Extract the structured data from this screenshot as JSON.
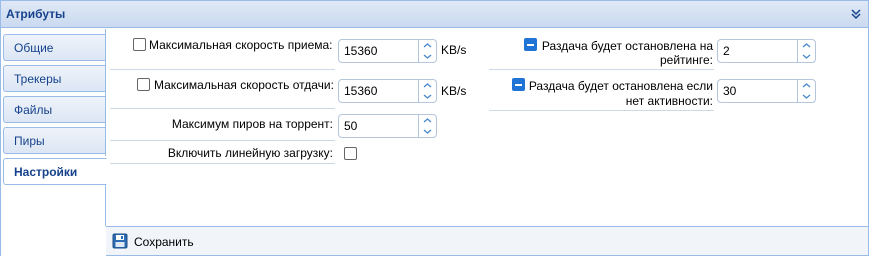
{
  "panel": {
    "title": "Атрибуты"
  },
  "tabs": [
    {
      "label": "Общие"
    },
    {
      "label": "Трекеры"
    },
    {
      "label": "Файлы"
    },
    {
      "label": "Пиры"
    },
    {
      "label": "Настройки",
      "active": true
    }
  ],
  "settings": {
    "max_download": {
      "label": "Максимальная скорость приема:",
      "value": "15360",
      "unit": "KB/s",
      "checked": false
    },
    "max_upload": {
      "label": "Максимальная скорость отдачи:",
      "value": "15360",
      "unit": "KB/s",
      "checked": false
    },
    "max_peers": {
      "label": "Максимум пиров на торрент:",
      "value": "50"
    },
    "sequential": {
      "label": "Включить линейную загрузку:",
      "checked": false
    },
    "stop_ratio": {
      "label_line1": "Раздача будет остановлена на",
      "label_line2": "рейтинге:",
      "value": "2",
      "checked": true
    },
    "stop_idle": {
      "label_line1": "Раздача будет остановлена если",
      "label_line2": "нет активности:",
      "value": "30",
      "checked": true
    }
  },
  "toolbar": {
    "save_label": "Сохранить"
  },
  "colors": {
    "accent": "#1f74d6",
    "header_text": "#15428b",
    "border": "#99bbe8"
  },
  "icons": {
    "collapse": "double-chevron-down-icon",
    "save": "floppy-disk-icon"
  }
}
